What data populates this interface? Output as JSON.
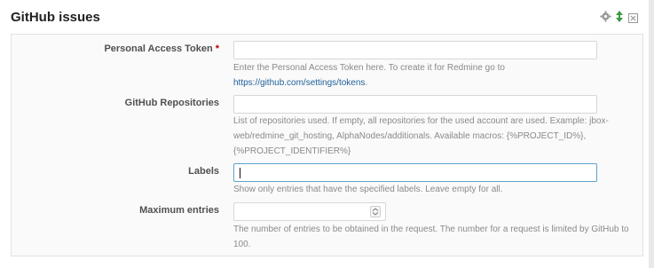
{
  "panel": {
    "title": "GitHub issues",
    "icons": [
      "gear-icon",
      "sort-arrows-icon",
      "close-icon"
    ]
  },
  "fields": {
    "token": {
      "label": "Personal Access Token",
      "required_mark": "*",
      "value": "",
      "help_prefix": "Enter the Personal Access Token here. To create it for Redmine go to ",
      "help_link": "https://github.com/settings/tokens",
      "help_suffix": "."
    },
    "repositories": {
      "label": "GitHub Repositories",
      "value": "",
      "help": "List of repositories used. If empty, all repositories for the used account are used. Example: jbox-web/redmine_git_hosting, AlphaNodes/additionals. Available macros: {%PROJECT_ID%}, {%PROJECT_IDENTIFIER%}"
    },
    "labels": {
      "label": "Labels",
      "value": "",
      "help": "Show only entries that have the specified labels. Leave empty for all."
    },
    "max_entries": {
      "label": "Maximum entries",
      "value": "",
      "help": "The number of entries to be obtained in the request. The number for a request is limited by GitHub to 100."
    }
  },
  "colors": {
    "link": "#1f5f99",
    "required": "#bb0000",
    "focus_border": "#5ea2c7"
  }
}
